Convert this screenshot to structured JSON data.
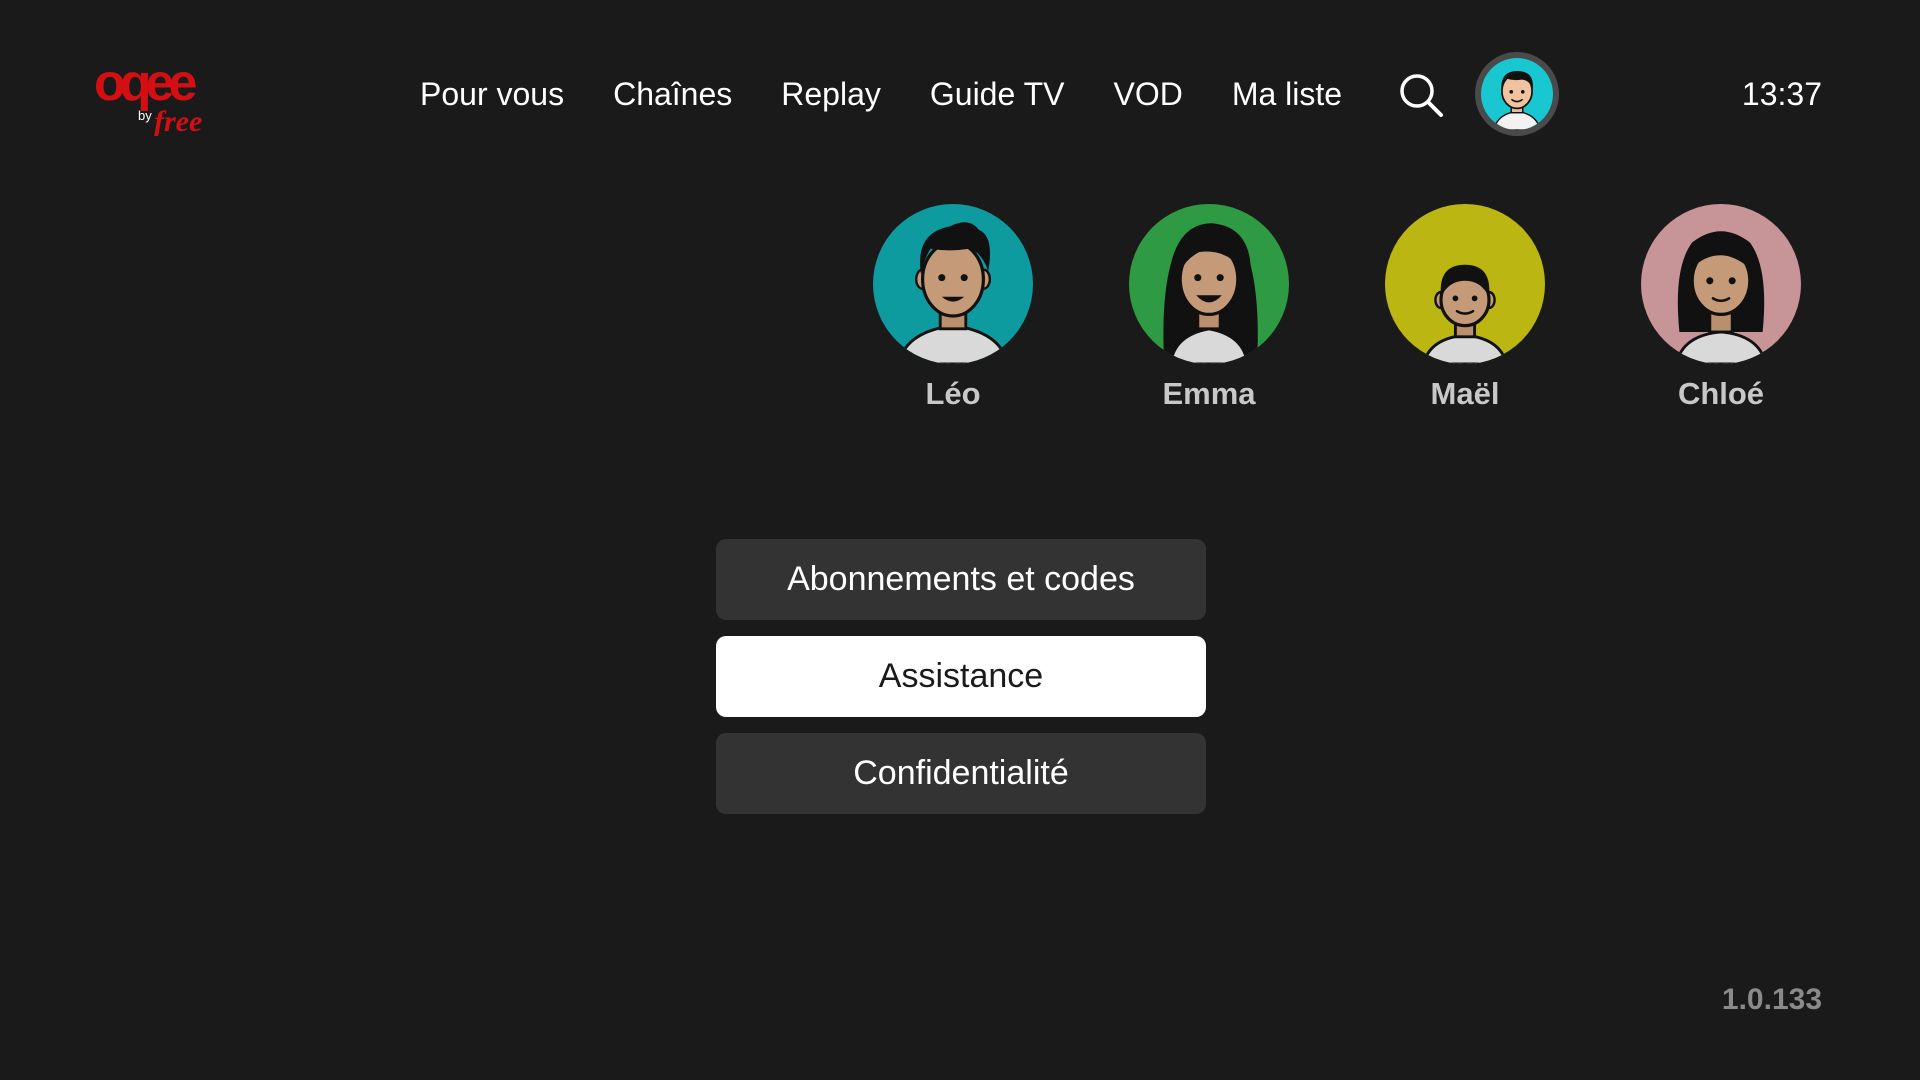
{
  "app": {
    "logo_main": "oqee",
    "logo_by": "by",
    "logo_brand": "free"
  },
  "nav": {
    "items": [
      {
        "label": "Pour vous"
      },
      {
        "label": "Chaînes"
      },
      {
        "label": "Replay"
      },
      {
        "label": "Guide TV"
      },
      {
        "label": "VOD"
      },
      {
        "label": "Ma liste"
      }
    ]
  },
  "header": {
    "search_icon": "search-icon",
    "avatar_icon": "profile-avatar-icon",
    "clock": "13:37"
  },
  "profiles": [
    {
      "name": "Léo",
      "color": "#0e9b9f"
    },
    {
      "name": "Emma",
      "color": "#2e9a44"
    },
    {
      "name": "Maël",
      "color": "#bcb612"
    },
    {
      "name": "Chloé",
      "color": "#c79498"
    }
  ],
  "menu": {
    "items": [
      {
        "label": "Abonnements et codes",
        "selected": false
      },
      {
        "label": "Assistance",
        "selected": true
      },
      {
        "label": "Confidentialité",
        "selected": false
      }
    ]
  },
  "footer": {
    "version": "1.0.133"
  },
  "colors": {
    "background": "#1a1a1a",
    "button_bg": "#333333",
    "button_selected_bg": "#ffffff",
    "logo_red": "#d40f14",
    "header_avatar_bg": "#18c7cf"
  }
}
